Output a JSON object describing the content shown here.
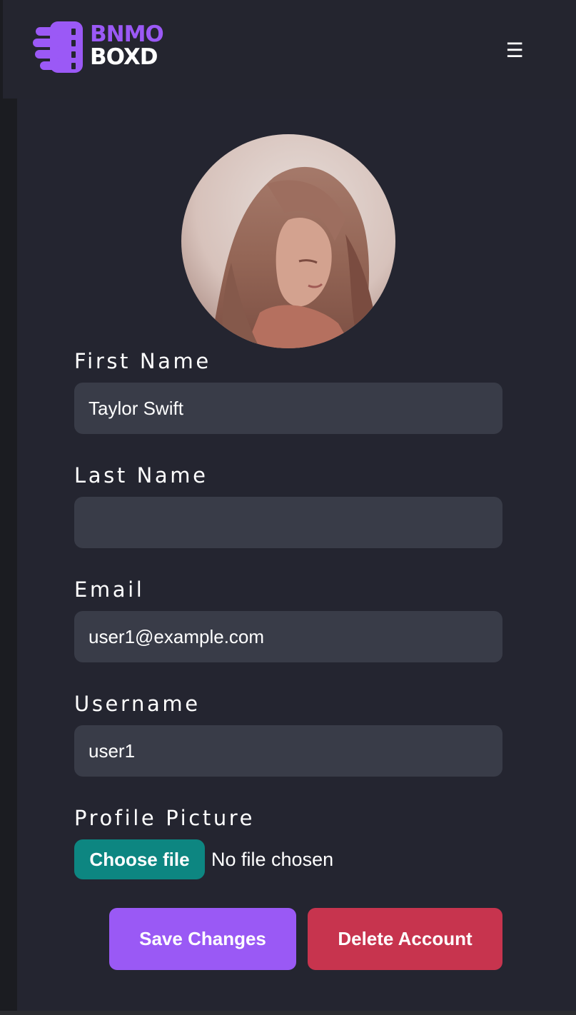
{
  "brand": {
    "top": "BNMO",
    "bottom": "BOXD",
    "accent_color": "#9b59f6"
  },
  "nav": {
    "menu_icon": "☰"
  },
  "profile": {
    "avatar_icon": "profile-photo"
  },
  "form": {
    "first_name": {
      "label": "First Name",
      "value": "Taylor Swift"
    },
    "last_name": {
      "label": "Last Name",
      "value": ""
    },
    "email": {
      "label": "Email",
      "value": "user1@example.com"
    },
    "username": {
      "label": "Username",
      "value": "user1"
    },
    "profile_picture": {
      "label": "Profile Picture",
      "button_label": "Choose file",
      "status": "No file chosen"
    }
  },
  "actions": {
    "save_label": "Save Changes",
    "delete_label": "Delete Account",
    "save_color": "#9a59f5",
    "delete_color": "#c7344e"
  }
}
